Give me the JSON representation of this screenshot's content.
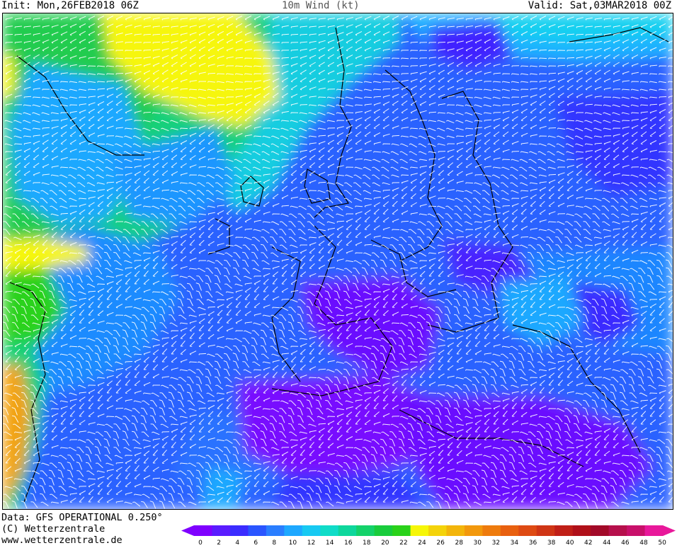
{
  "header": {
    "init": "Init: Mon,26FEB2018 06Z",
    "title": "10m Wind (kt)",
    "valid": "Valid: Sat,03MAR2018 00Z"
  },
  "footer": {
    "data_source": "Data: GFS OPERATIONAL 0.250°",
    "copyright": "(C) Wetterzentrale",
    "website": "www.wetterzentrale.de"
  },
  "legend": {
    "ticks": [
      "0",
      "2",
      "4",
      "6",
      "8",
      "10",
      "12",
      "14",
      "16",
      "18",
      "20",
      "22",
      "24",
      "26",
      "28",
      "30",
      "32",
      "34",
      "36",
      "38",
      "40",
      "42",
      "44",
      "46",
      "48",
      "50"
    ],
    "colors": [
      "#7f00ff",
      "#5a1cff",
      "#3b2cff",
      "#2a55ff",
      "#2a7eff",
      "#1ea8ff",
      "#17c9f2",
      "#10dcc8",
      "#0ed79c",
      "#14d26a",
      "#19cc3c",
      "#2ad21a",
      "#f6f608",
      "#f4d30a",
      "#f3b50b",
      "#f2980c",
      "#ee7b0d",
      "#e8600f",
      "#de4a13",
      "#cf3515",
      "#c01f17",
      "#b01019",
      "#a20a28",
      "#b6104c",
      "#c8106a",
      "#e8189a"
    ]
  }
}
